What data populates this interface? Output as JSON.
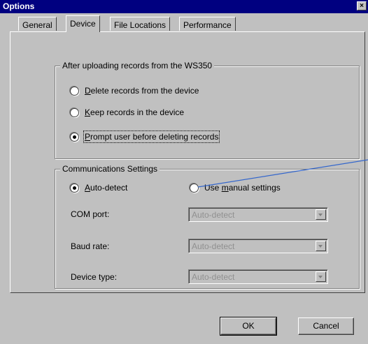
{
  "window": {
    "title": "Options",
    "close_glyph": "×"
  },
  "tabs": [
    {
      "label": "General",
      "active": false
    },
    {
      "label": "Device",
      "active": true
    },
    {
      "label": "File Locations",
      "active": false
    },
    {
      "label": "Performance",
      "active": false
    }
  ],
  "upload_group": {
    "legend": "After uploading records from the WS350",
    "options": [
      {
        "prefix": "",
        "mnemonic": "D",
        "rest": "elete records from the device",
        "checked": false
      },
      {
        "prefix": "",
        "mnemonic": "K",
        "rest": "eep records in the device",
        "checked": false
      },
      {
        "prefix": "",
        "mnemonic": "P",
        "rest": "rompt user before deleting records",
        "checked": true
      }
    ]
  },
  "comm_group": {
    "legend": "Communications Settings",
    "auto_detect": {
      "prefix": "",
      "mnemonic": "A",
      "rest": "uto-detect",
      "checked": true
    },
    "manual": {
      "prefix": "Use ",
      "mnemonic": "m",
      "rest": "anual settings",
      "checked": false
    },
    "fields": [
      {
        "label": "COM port:",
        "value": "Auto-detect"
      },
      {
        "label": "Baud rate:",
        "value": "Auto-detect"
      },
      {
        "label": "Device type:",
        "value": "Auto-detect"
      }
    ]
  },
  "buttons": {
    "ok": "OK",
    "cancel": "Cancel"
  },
  "colors": {
    "titlebar": "#000080",
    "face": "#c0c0c0",
    "callout_line": "#3366cc",
    "disabled_text": "#909090"
  }
}
